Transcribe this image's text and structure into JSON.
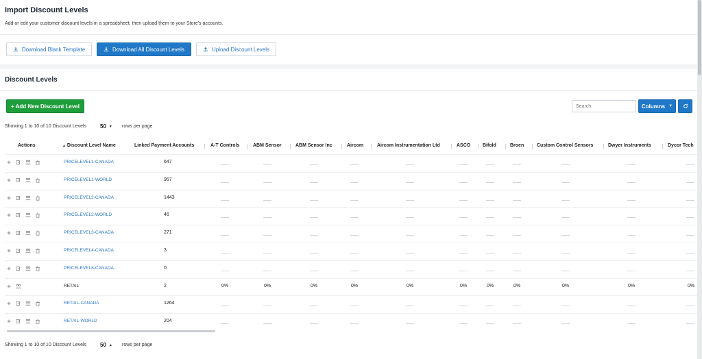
{
  "import": {
    "title": "Import Discount Levels",
    "description": "Add or edit your customer discount levels in a spreadsheet, then upload them to your Store's accounts.",
    "buttons": {
      "download_blank": "Download Blank Template",
      "download_all": "Download All Discount Levels",
      "upload": "Upload Discount Levels"
    }
  },
  "levels": {
    "title": "Discount Levels",
    "add_button": "+ Add New Discount Level",
    "search_placeholder": "Search",
    "columns_button": "Columns",
    "showing_text": "Showing 1 to 10 of 10 Discount Levels",
    "rows_value": "50",
    "rows_label": "rows per page"
  },
  "table": {
    "headers": {
      "actions": "Actions",
      "name": "Discount Level Name",
      "linked": "Linked Payment Accounts",
      "brands": [
        "A-T Controls",
        "ABM Sensor",
        "ABM Sensor Inc",
        "Aircom",
        "Aircom Instrumentation Ltd",
        "ASCO",
        "Bifold",
        "Broen",
        "Custom Control Sensors",
        "Dwyer Instruments",
        "Dycor Tech"
      ]
    },
    "rows": [
      {
        "name": "PRICELEVEL1-CANADA",
        "count": "647",
        "values": null
      },
      {
        "name": "PRICELEVEL1-WORLD",
        "count": "957",
        "values": null
      },
      {
        "name": "PRICELEVEL2-CANADA",
        "count": "1443",
        "values": null
      },
      {
        "name": "PRICELEVEL2-WORLD",
        "count": "46",
        "values": null
      },
      {
        "name": "PRICELEVEL3-CANADA",
        "count": "271",
        "values": null
      },
      {
        "name": "PRICELEVEL4-CANADA",
        "count": "3",
        "values": null
      },
      {
        "name": "PRICELEVEL8-CANADA",
        "count": "0",
        "values": null
      },
      {
        "name": "RETAIL",
        "count": "2",
        "values": [
          "0%",
          "0%",
          "0%",
          "0%",
          "0%",
          "0%",
          "0%",
          "0%",
          "0%",
          "0%",
          "0%"
        ]
      },
      {
        "name": "RETAIL-CANADA",
        "count": "1264",
        "values": null
      },
      {
        "name": "RETAIL-WORLD",
        "count": "204",
        "values": null
      }
    ]
  },
  "colors": {
    "primary": "#1f78c8",
    "success": "#1e9e3a",
    "link": "#2b76c8"
  }
}
